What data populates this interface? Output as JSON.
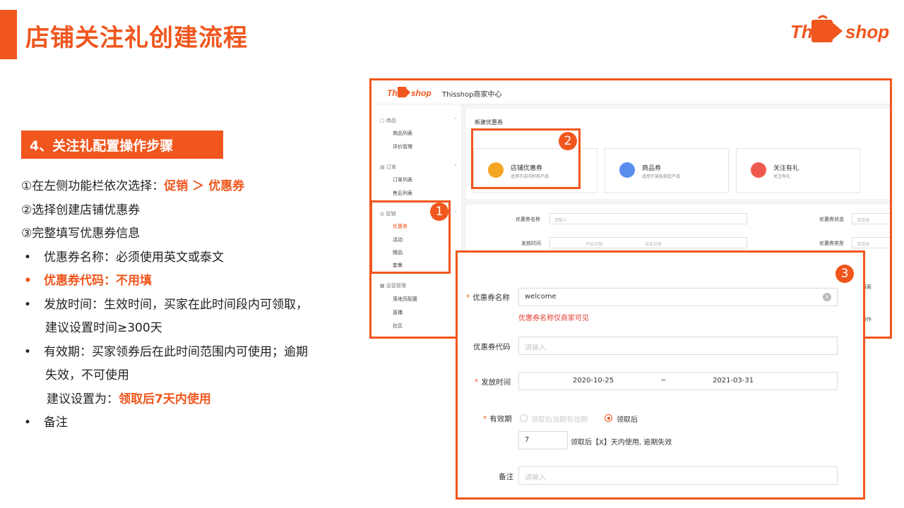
{
  "slide": {
    "title": "店铺关注礼创建流程",
    "brand_left": "This",
    "brand_right": "shop",
    "step_heading": "4、关注礼配置操作步骤"
  },
  "instructions": {
    "l1_prefix": "①在左侧功能栏依次选择：",
    "l1_hl": "促销 ＞ 优惠券",
    "l2": "②选择创建店铺优惠券",
    "l3": "③完整填写优惠券信息",
    "bullet": "•",
    "b1": "优惠券名称：必须使用英文或泰文",
    "b2": "优惠券代码：不用填",
    "b3a": "发放时间：生效时间，买家在此时间段内可领取，",
    "b3b": "建议设置时间≥300天",
    "b4a": "有效期：买家领券后在此时间范围内可使用；逾期",
    "b4b": "失效，不可使用",
    "b4c_prefix": "建议设置为：",
    "b4c_hl": "领取后7天内使用",
    "b5": "备注"
  },
  "mock": {
    "app_title": "Thisshop商家中心",
    "sidebar": {
      "g1": "商品",
      "g1_items": [
        "商品列表",
        "评价管理"
      ],
      "g2": "订单",
      "g2_items": [
        "订单列表",
        "售后列表"
      ],
      "g3": "促销",
      "g3_items": [
        "优惠券",
        "活动",
        "赠品",
        "套餐"
      ],
      "g4": "运营管理",
      "g4_items": [
        "落地页配置",
        "直播",
        "社区"
      ]
    },
    "new_coupon_title": "新建优惠券",
    "cards": [
      {
        "title": "店铺优惠券",
        "sub": "适用于店内所有产品",
        "color": "#f5a623"
      },
      {
        "title": "商品券",
        "sub": "适用于某些指定产品",
        "color": "#5b8def"
      },
      {
        "title": "关注有礼",
        "sub": "关注有礼",
        "color": "#ef5a4e"
      }
    ],
    "form": {
      "coupon_name": "优惠券名称",
      "coupon_name_ph": "请输入",
      "coupon_status": "优惠券状态",
      "coupon_status_ph": "请选择",
      "issue_time": "发放时间",
      "start_ph": "开始日期",
      "end_ph": "结束日期",
      "coupon_type": "优惠券类型",
      "coupon_type_ph": "请选择",
      "right_frag1": "搜索",
      "right_frag2": "操作"
    }
  },
  "badges": [
    "1",
    "2",
    "3"
  ],
  "popup": {
    "name_label": "优惠券名称",
    "name_value": "welcome",
    "name_error": "优惠券名称仅商家可见",
    "code_label": "优惠券代码",
    "code_ph": "请输入",
    "time_label": "发放时间",
    "time_start": "2020-10-25",
    "time_sep": "~",
    "time_end": "2021-03-31",
    "valid_label": "有效期",
    "valid_opt1": "领取后当期有效期",
    "valid_opt2": "领取后",
    "days_value": "7",
    "days_text": "领取后【X】天内使用, 逾期失效",
    "remark_label": "备注",
    "remark_ph": "请输入"
  }
}
